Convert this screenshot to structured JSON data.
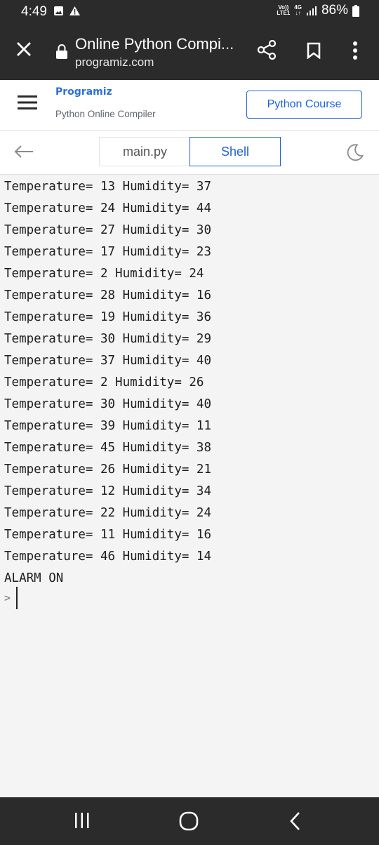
{
  "status": {
    "time": "4:49",
    "volte_top": "Vo))",
    "volte_bottom": "LTE1",
    "network": "4G",
    "battery": "86%"
  },
  "browser": {
    "title": "Online Python Compi...",
    "url": "programiz.com"
  },
  "site": {
    "logo": "Programiz",
    "subtitle": "Python Online Compiler",
    "course_button": "Python Course"
  },
  "tabs": {
    "main": "main.py",
    "shell": "Shell"
  },
  "output": [
    "Temperature= 13 Humidity= 37",
    "Temperature= 24 Humidity= 44",
    "Temperature= 27 Humidity= 30",
    "Temperature= 17 Humidity= 23",
    "Temperature= 2 Humidity= 24",
    "Temperature= 28 Humidity= 16",
    "Temperature= 19 Humidity= 36",
    "Temperature= 30 Humidity= 29",
    "Temperature= 37 Humidity= 40",
    "Temperature= 2 Humidity= 26",
    "Temperature= 30 Humidity= 40",
    "Temperature= 39 Humidity= 11",
    "Temperature= 45 Humidity= 38",
    "Temperature= 26 Humidity= 21",
    "Temperature= 12 Humidity= 34",
    "Temperature= 22 Humidity= 24",
    "Temperature= 11 Humidity= 16",
    "Temperature= 46 Humidity= 14",
    "ALARM ON"
  ],
  "prompt": ">",
  "colors": {
    "accent": "#1f62d6",
    "chrome": "#2b2b2b"
  }
}
